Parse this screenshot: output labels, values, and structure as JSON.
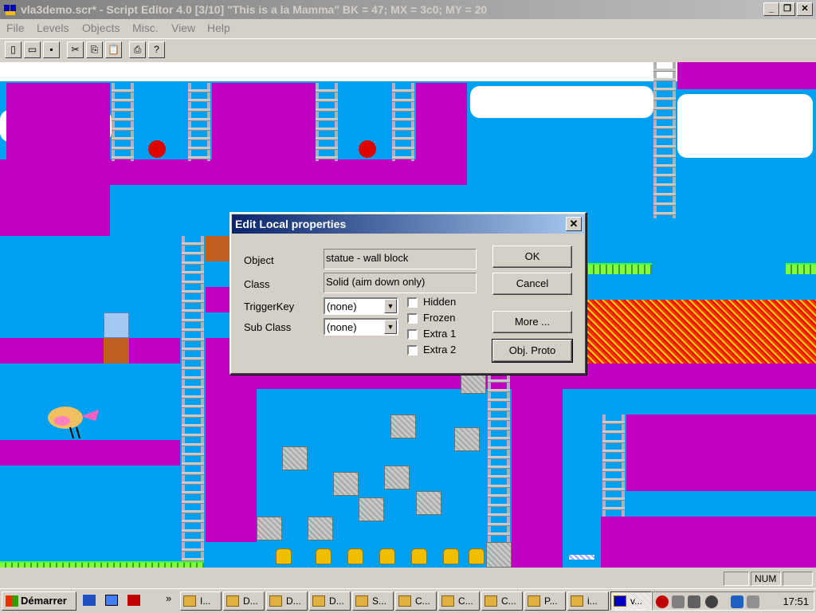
{
  "window": {
    "title": "vla3demo.scr* - Script Editor 4.0 [3/10] \"This is a la Mamma\" BK = 47; MX = 3c0; MY = 20",
    "minimize_label": "_",
    "maximize_label": "❐",
    "close_label": "✕"
  },
  "menu": [
    "File",
    "Levels",
    "Objects",
    "Misc.",
    "View",
    "Help"
  ],
  "toolbar": {
    "new": "▯",
    "open": "▭",
    "save": "▪",
    "cut": "✂",
    "copy": "⎘",
    "paste": "📋",
    "print": "⎙",
    "help": "?"
  },
  "dialog": {
    "title": "Edit Local properties",
    "close_label": "✕",
    "object_label": "Object",
    "object_value": "statue - wall block",
    "class_label": "Class",
    "class_value": "Solid (aim down only)",
    "triggerkey_label": "TriggerKey",
    "triggerkey_value": "(none)",
    "subclass_label": "Sub Class",
    "subclass_value": "(none)",
    "checkboxes": [
      "Hidden",
      "Frozen",
      "Extra 1",
      "Extra 2"
    ],
    "ok": "OK",
    "cancel": "Cancel",
    "more": "More ...",
    "objproto": "Obj. Proto"
  },
  "statusbar": {
    "num": "NUM"
  },
  "taskbar": {
    "start": "Démarrer",
    "tasks": [
      "I...",
      "D...",
      "D...",
      "D...",
      "S...",
      "C...",
      "C...",
      "C...",
      "P...",
      "i...",
      "v..."
    ],
    "clock": "17:51"
  }
}
